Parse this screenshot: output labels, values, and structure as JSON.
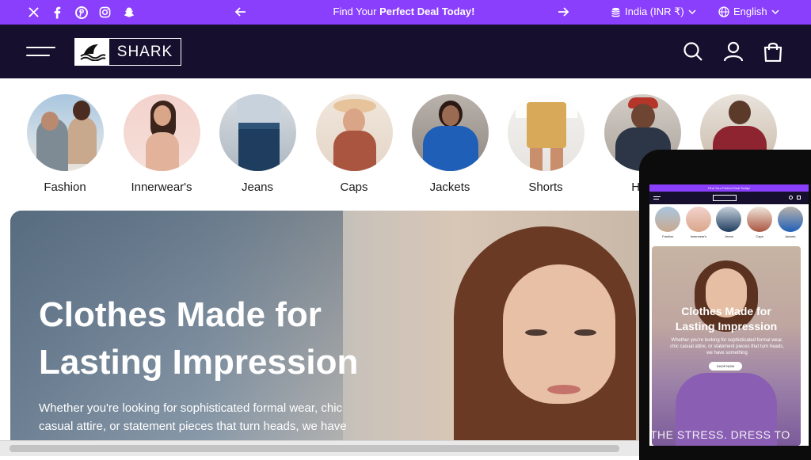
{
  "announcement": {
    "social_icons": [
      "x-icon",
      "facebook-icon",
      "pinterest-icon",
      "instagram-icon",
      "snapchat-icon"
    ],
    "promo_prefix": "Find Your ",
    "promo_bold": "Perfect Deal Today!",
    "currency": "India (INR ₹)",
    "language": "English",
    "bg_color": "#8a3ffc"
  },
  "header": {
    "logo_text": "SHARK",
    "bg_color": "#160f2d",
    "icons": [
      "search-icon",
      "account-icon",
      "cart-icon"
    ]
  },
  "categories": [
    {
      "label": "Fashion"
    },
    {
      "label": "Innerwear's"
    },
    {
      "label": "Jeans"
    },
    {
      "label": "Caps"
    },
    {
      "label": "Jackets"
    },
    {
      "label": "Shorts"
    },
    {
      "label": "Hoo"
    },
    {
      "label": ""
    }
  ],
  "hero": {
    "title_line1": "Clothes Made for",
    "title_line2": "Lasting Impression",
    "text_line1": "Whether you're looking for sophisticated formal wear, chic",
    "text_line2": "casual attire, or statement pieces that turn heads, we have"
  },
  "mobile_preview": {
    "promo": "Find Your Perfect Deal Today!",
    "categories": [
      "Fashion",
      "Innerwear's",
      "Jeans",
      "Caps",
      "Jackets"
    ],
    "hero_title_line1": "Clothes Made for",
    "hero_title_line2": "Lasting Impression",
    "hero_text": "Whether you're looking for sophisticated formal wear, chic casual attire, or statement pieces that turn heads, we have something",
    "button_label": "SHOP NOW",
    "marquee": "THE STRESS. DRESS TO"
  }
}
